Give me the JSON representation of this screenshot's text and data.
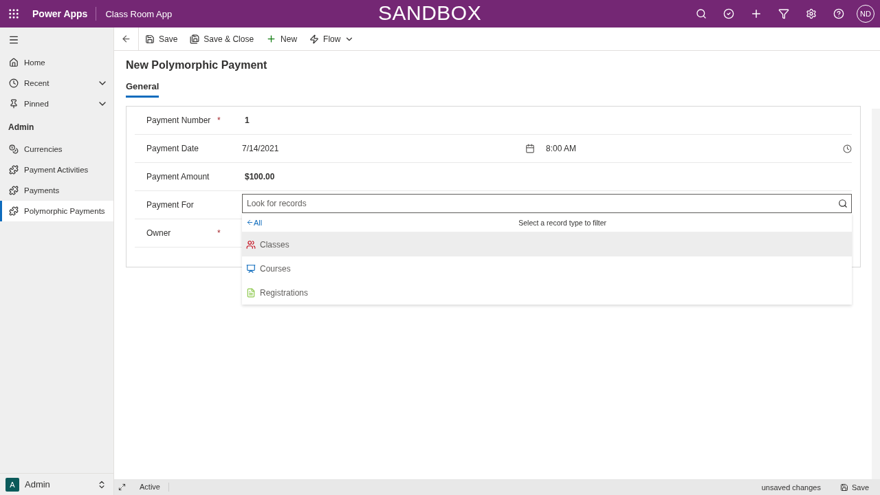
{
  "top_bar": {
    "brand": "Power Apps",
    "app_name": "Class Room App",
    "environment": "SANDBOX",
    "user_initials": "ND"
  },
  "command_bar": {
    "items": [
      {
        "kind": "save",
        "label": "Save"
      },
      {
        "kind": "save_close",
        "label": "Save & Close"
      },
      {
        "kind": "new",
        "label": "New"
      },
      {
        "kind": "flow",
        "label": "Flow"
      }
    ]
  },
  "sidebar": {
    "nav": [
      {
        "kind": "home",
        "label": "Home",
        "expandable": false
      },
      {
        "kind": "recent",
        "label": "Recent",
        "expandable": true
      },
      {
        "kind": "pinned",
        "label": "Pinned",
        "expandable": true
      }
    ],
    "section": "Admin",
    "entities": [
      {
        "kind": "currency",
        "label": "Currencies",
        "selected": false
      },
      {
        "kind": "entity",
        "label": "Payment Activities",
        "selected": false
      },
      {
        "kind": "entity",
        "label": "Payments",
        "selected": false
      },
      {
        "kind": "entity",
        "label": "Polymorphic Payments",
        "selected": true
      }
    ],
    "area": {
      "initial": "A",
      "label": "Admin"
    }
  },
  "form": {
    "title": "New Polymorphic Payment",
    "required_mark": "*",
    "tabs": [
      {
        "label": "General",
        "selected": true
      }
    ],
    "fields": [
      {
        "kind": "text",
        "label": "Payment Number",
        "required": true,
        "value": "1"
      },
      {
        "kind": "datetime",
        "label": "Payment Date",
        "required": false,
        "value": "7/14/2021",
        "time": "8:00 AM"
      },
      {
        "kind": "text",
        "label": "Payment Amount",
        "required": false,
        "value": "$100.00"
      },
      {
        "kind": "lookup",
        "label": "Payment For",
        "required": false,
        "placeholder": "Look for records"
      },
      {
        "kind": "owner",
        "label": "Owner",
        "required": true
      }
    ]
  },
  "lookup_dropdown": {
    "back_label": "All",
    "hint": "Select a record type to filter",
    "items": [
      {
        "kind": "classes",
        "label": "Classes",
        "selected": true
      },
      {
        "kind": "courses",
        "label": "Courses",
        "selected": false
      },
      {
        "kind": "registrations",
        "label": "Registrations",
        "selected": false
      }
    ]
  },
  "status_bar": {
    "status": "Active",
    "unsaved": "unsaved changes",
    "save_label": "Save"
  }
}
